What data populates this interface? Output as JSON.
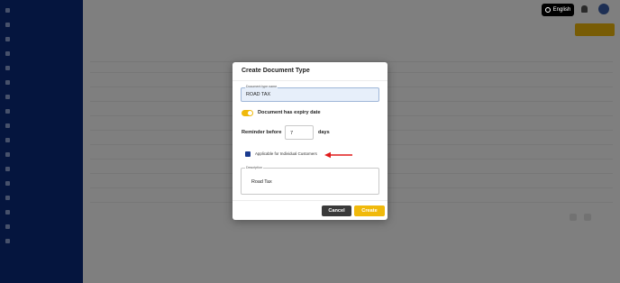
{
  "header": {
    "language_label": "English"
  },
  "dialog": {
    "title": "Create Document Type",
    "name_field": {
      "legend": "Document type name",
      "value": "ROAD TAX"
    },
    "expiry_toggle": {
      "label": "Document has expiry date",
      "on": true
    },
    "reminder": {
      "label": "Reminder before",
      "value": "7",
      "unit": "days"
    },
    "individual_checkbox": {
      "label": "Applicable for Individual Customers",
      "checked": true
    },
    "description_field": {
      "legend": "Description",
      "value": "Road Tax"
    },
    "cancel_label": "Cancel",
    "create_label": "Create"
  },
  "colors": {
    "accent": "#f0b90b",
    "sidebar": "#0a2b7c",
    "checkbox": "#1a3b8f",
    "annotation_arrow": "#e01b1b"
  },
  "icons": {
    "language": "globe-ring-icon",
    "notifications": "bell-icon",
    "annotation": "red-arrow-icon"
  }
}
